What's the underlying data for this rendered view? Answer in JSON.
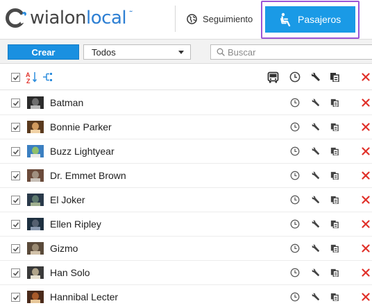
{
  "header": {
    "logo": {
      "part1": "wialon",
      "part2": "local"
    },
    "tabs": {
      "seguimiento": {
        "label": "Seguimiento",
        "icon": "globe-icon"
      },
      "pasajeros": {
        "label": "Pasajeros",
        "icon": "passenger-seat-icon",
        "active": true
      }
    }
  },
  "toolbar": {
    "create_label": "Crear",
    "filter_value": "Todos",
    "search_placeholder": "Buscar"
  },
  "colors": {
    "accent": "#1a9ae6",
    "active_outline": "#9b55d6",
    "delete": "#e0312a",
    "sort_icon": "#e0312a",
    "group_icon": "#2d8ddd"
  },
  "list_header": {
    "icons": [
      "select-all-checkbox",
      "sort-az-icon",
      "group-icon",
      "bus-icon",
      "clock-icon",
      "wrench-icon",
      "copy-icon",
      "delete-icon"
    ]
  },
  "passengers": [
    {
      "name": "Batman",
      "avatar_colors": [
        "#2b2b2b",
        "#6e6e6e",
        "#b8b8b8"
      ]
    },
    {
      "name": "Bonnie Parker",
      "avatar_colors": [
        "#5a3a1e",
        "#d19a5e",
        "#f1d2a6"
      ]
    },
    {
      "name": "Buzz Lightyear",
      "avatar_colors": [
        "#3b7fc1",
        "#8fbf6a",
        "#e8e8e8"
      ]
    },
    {
      "name": "Dr. Emmet Brown",
      "avatar_colors": [
        "#6b4b3b",
        "#a09080",
        "#c8c0b8"
      ]
    },
    {
      "name": "El Joker",
      "avatar_colors": [
        "#2a3a4a",
        "#5e7a6e",
        "#a0b090"
      ]
    },
    {
      "name": "Ellen Ripley",
      "avatar_colors": [
        "#1e3040",
        "#556070",
        "#8a9ab0"
      ]
    },
    {
      "name": "Gizmo",
      "avatar_colors": [
        "#5a4a3a",
        "#9a8a72",
        "#d2c2aa"
      ]
    },
    {
      "name": "Han Solo",
      "avatar_colors": [
        "#3a3a3a",
        "#b0a48a",
        "#e6e0d0"
      ]
    },
    {
      "name": "Hannibal Lecter",
      "avatar_colors": [
        "#4a2a1a",
        "#a85a2a",
        "#e8c89a"
      ]
    }
  ]
}
